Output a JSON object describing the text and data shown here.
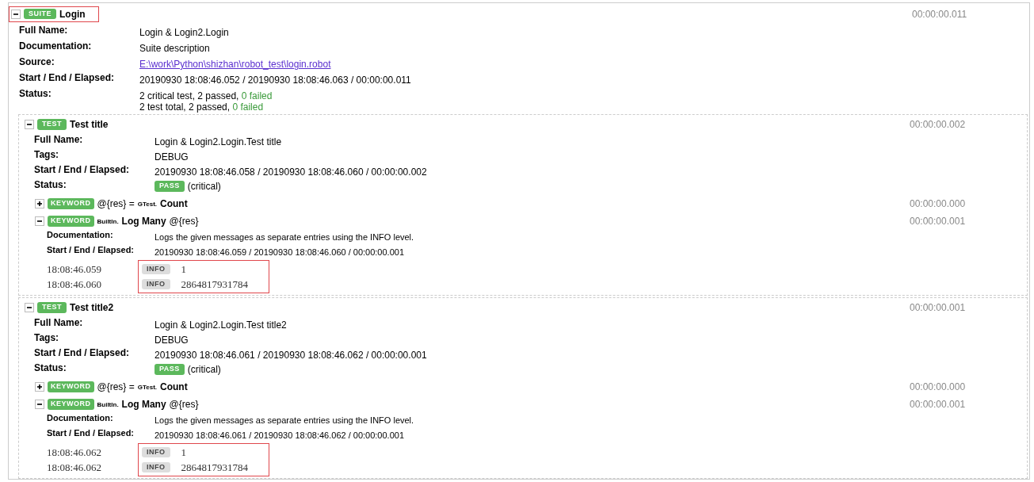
{
  "suite": {
    "expanded": true,
    "highlighted": true,
    "badge": "SUITE",
    "name": "Login",
    "elapsed": "00:00:00.011",
    "metadata": [
      {
        "kind": "text",
        "label": "Full Name:",
        "value": "Login & Login2.Login"
      },
      {
        "kind": "text",
        "label": "Documentation:",
        "value": "Suite description"
      },
      {
        "kind": "link",
        "label": "Source:",
        "value": "E:\\work\\Python\\shizhan\\robot_test\\login.robot"
      },
      {
        "kind": "text",
        "label": "Start / End / Elapsed:",
        "value": "20190930 18:08:46.052 / 20190930 18:08:46.063 / 00:00:00.011"
      }
    ],
    "status": {
      "label": "Status:",
      "lines": [
        {
          "summary": "2 critical test, 2 passed,",
          "failed": "0 failed"
        },
        {
          "summary": "2 test total, 2 passed,",
          "failed": "0 failed"
        }
      ]
    },
    "tests": [
      {
        "expanded": true,
        "badge": "TEST",
        "name": "Test title",
        "elapsed": "00:00:00.002",
        "metadata": [
          {
            "label": "Full Name:",
            "value": "Login & Login2.Login.Test title"
          },
          {
            "label": "Tags:",
            "value": "DEBUG"
          },
          {
            "label": "Start / End / Elapsed:",
            "value": "20190930 18:08:46.058 / 20190930 18:08:46.060 / 00:00:00.002"
          }
        ],
        "status": {
          "label": "Status:",
          "result": "PASS",
          "note": "(critical)"
        },
        "keywords": [
          {
            "expanded": false,
            "badge": "KEYWORD",
            "assign": "@{res} =",
            "library": "GTest.",
            "name": "Count",
            "elapsed": "00:00:00.000"
          },
          {
            "expanded": true,
            "badge": "KEYWORD",
            "library": "BuiltIn.",
            "name": "Log Many",
            "args": "@{res}",
            "elapsed": "00:00:00.001",
            "metadata": [
              {
                "label": "Documentation:",
                "value": "Logs the given messages as separate entries using the INFO level."
              },
              {
                "label": "Start / End / Elapsed:",
                "value": "20190930 18:08:46.059 / 20190930 18:08:46.060 / 00:00:00.001"
              }
            ],
            "messages_highlighted": true,
            "messages": [
              {
                "time": "18:08:46.059",
                "level": "INFO",
                "text": "1"
              },
              {
                "time": "18:08:46.060",
                "level": "INFO",
                "text": "2864817931784"
              }
            ]
          }
        ]
      },
      {
        "expanded": true,
        "badge": "TEST",
        "name": "Test title2",
        "elapsed": "00:00:00.001",
        "metadata": [
          {
            "label": "Full Name:",
            "value": "Login & Login2.Login.Test title2"
          },
          {
            "label": "Tags:",
            "value": "DEBUG"
          },
          {
            "label": "Start / End / Elapsed:",
            "value": "20190930 18:08:46.061 / 20190930 18:08:46.062 / 00:00:00.001"
          }
        ],
        "status": {
          "label": "Status:",
          "result": "PASS",
          "note": "(critical)"
        },
        "keywords": [
          {
            "expanded": false,
            "badge": "KEYWORD",
            "assign": "@{res} =",
            "library": "GTest.",
            "name": "Count",
            "elapsed": "00:00:00.000"
          },
          {
            "expanded": true,
            "badge": "KEYWORD",
            "library": "BuiltIn.",
            "name": "Log Many",
            "args": "@{res}",
            "elapsed": "00:00:00.001",
            "metadata": [
              {
                "label": "Documentation:",
                "value": "Logs the given messages as separate entries using the INFO level."
              },
              {
                "label": "Start / End / Elapsed:",
                "value": "20190930 18:08:46.061 / 20190930 18:08:46.062 / 00:00:00.001"
              }
            ],
            "messages_highlighted": true,
            "messages": [
              {
                "time": "18:08:46.062",
                "level": "INFO",
                "text": "1"
              },
              {
                "time": "18:08:46.062",
                "level": "INFO",
                "text": "2864817931784"
              }
            ]
          }
        ]
      }
    ]
  }
}
